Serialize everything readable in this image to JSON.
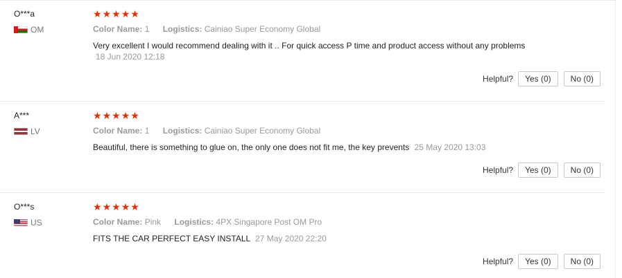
{
  "reviews": [
    {
      "user": "O***a",
      "country": "OM",
      "rating": 5,
      "color_label": "Color Name:",
      "color_value": "1",
      "logistics_label": "Logistics:",
      "logistics_value": "Cainiao Super Economy Global",
      "text": "Very excellent I would recommend dealing with it .. For quick access P time and product access without any problems",
      "date": "18 Jun 2020 12:18",
      "helpful_label": "Helpful?",
      "yes_label": "Yes (0)",
      "no_label": "No (0)"
    },
    {
      "user": "A***",
      "country": "LV",
      "rating": 5,
      "color_label": "Color Name:",
      "color_value": "1",
      "logistics_label": "Logistics:",
      "logistics_value": "Cainiao Super Economy Global",
      "text": "Beautiful, there is something to glue on, the only one does not fit me, the key prevents",
      "date": "25 May 2020 13:03",
      "helpful_label": "Helpful?",
      "yes_label": "Yes (0)",
      "no_label": "No (0)"
    },
    {
      "user": "O***s",
      "country": "US",
      "rating": 5,
      "color_label": "Color Name:",
      "color_value": "Pink",
      "logistics_label": "Logistics:",
      "logistics_value": "4PX Singapore Post OM Pro",
      "text": "FITS THE CAR PERFECT EASY INSTALL",
      "date": "27 May 2020 22:20",
      "helpful_label": "Helpful?",
      "yes_label": "Yes (0)",
      "no_label": "No (0)"
    }
  ],
  "colors": {
    "star": "#e62e04",
    "muted": "#999999",
    "text": "#222222",
    "border": "#c9c9c9"
  },
  "icons": {
    "star": "star-icon",
    "flags": [
      "oman-flag-icon",
      "latvia-flag-icon",
      "usa-flag-icon"
    ]
  }
}
